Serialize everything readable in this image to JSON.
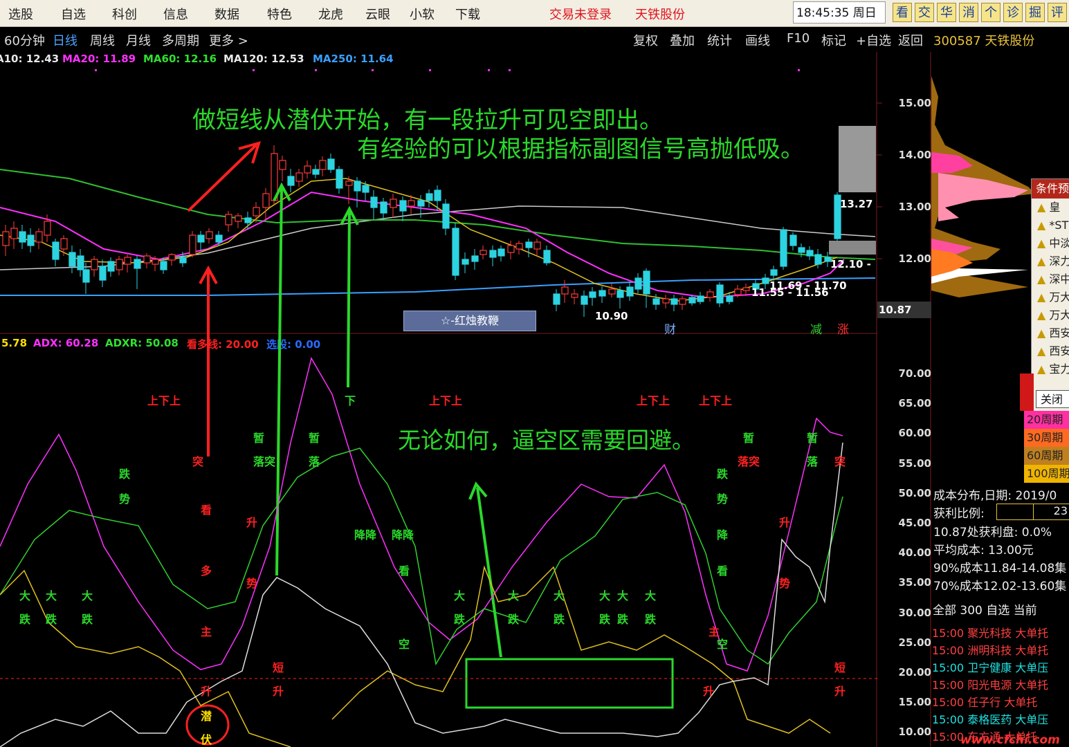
{
  "topbar": {
    "menu": [
      "选股",
      "自选",
      "科创",
      "信息",
      "数据",
      "特色",
      "龙虎",
      "云眼",
      "小软",
      "下载"
    ],
    "login_status": "交易未登录",
    "company": "天铁股份",
    "time": "18:45:35",
    "weekday": "周日",
    "quick_buttons": [
      "看",
      "交",
      "华",
      "消",
      "个",
      "诊",
      "掘",
      "评"
    ]
  },
  "subbar": {
    "periods": [
      "60分钟",
      "日线",
      "周线",
      "月线",
      "多周期",
      "更多 >"
    ],
    "active_period": "日线",
    "tools": [
      "复权",
      "叠加",
      "统计",
      "画线",
      "F10",
      "标记",
      "+自选",
      "返回"
    ],
    "stock_code_name": "300587 天铁股份"
  },
  "ma_legend": [
    {
      "text": "A10: 12.43",
      "color": "#e8e8e8"
    },
    {
      "text": "MA20: 11.89",
      "color": "#ff30ff"
    },
    {
      "text": "MA60: 12.16",
      "color": "#30e030"
    },
    {
      "text": "MA120: 12.53",
      "color": "#e8e8e8"
    },
    {
      "text": "MA250: 11.64",
      "color": "#3aa0ff"
    }
  ],
  "adx_legend": [
    {
      "text": "5.78",
      "color": "#ffe000"
    },
    {
      "text": "ADX: 60.28",
      "color": "#ff30ff"
    },
    {
      "text": "ADXR: 50.08",
      "color": "#30e030"
    },
    {
      "text": "看多线: 20.00",
      "color": "#ff2020"
    },
    {
      "text": "选股: 0.00",
      "color": "#2a6bff"
    }
  ],
  "price_axis": [
    "15.00",
    "14.00",
    "13.00",
    "12.00"
  ],
  "low_axis_label": "10.87",
  "indicator_axis": [
    "70.00",
    "65.00",
    "60.00",
    "55.00",
    "50.00",
    "45.00",
    "40.00",
    "35.00",
    "30.00",
    "25.00",
    "20.00",
    "15.00",
    "10.00"
  ],
  "price_labels": {
    "high": "13.27",
    "last": "12.10 -",
    "low": "10.90",
    "near1": "11.69 - 11.70",
    "near2": "11.55 - 11.56"
  },
  "pattern_badge": "☆-红烛教鞭",
  "event_markers": [
    "财",
    "减",
    "涨"
  ],
  "annotations": {
    "line1": "做短线从潜伏开始，有一段拉升可见空即出。",
    "line2": "有经验的可以根据指标副图信号高抛低吸。",
    "line3": "无论如何，逼空区需要回避。"
  },
  "signals": {
    "shang_xia": "上下上",
    "xia": "下",
    "zan": "暂",
    "luo": "落",
    "luo_tu": "落突",
    "tu": "突",
    "die": "跌",
    "shi": "势",
    "kan": "看",
    "sheng": "升",
    "duo": "多",
    "zhu": "主",
    "kong": "空",
    "da": "大",
    "duan": "短",
    "qian": "潜",
    "fu": "伏",
    "xiang_jiang": "降降",
    "jiang": "降"
  },
  "right_panel": {
    "popup_title": "条件预",
    "popup_items": [
      "皇",
      "*ST",
      "中淡",
      "深力",
      "深中",
      "万大",
      "万大",
      "西安",
      "西安",
      "宝力"
    ],
    "close_btn": "关闭",
    "periods": [
      "20周期",
      "30周期",
      "60周期",
      "100周期"
    ],
    "cost_date": "成本分布,日期: 2019/0",
    "profit_ratio_label": "获利比例:",
    "profit_ratio_value": "23",
    "profit_at": "10.87处获利盘: 0.0%",
    "avg_cost": "平均成本: 13.00元",
    "cost90": "90%成本11.84-14.08集",
    "cost70": "70%成本12.02-13.60集",
    "list_header": "全部 300  自选  当前",
    "stocks": [
      {
        "time": "15:00",
        "name": "聚光科技",
        "type": "大单托",
        "color": "#ff4040"
      },
      {
        "time": "15:00",
        "name": "洲明科技",
        "type": "大单托",
        "color": "#ff4040"
      },
      {
        "time": "15:00",
        "name": "卫宁健康",
        "type": "大单压",
        "color": "#20e0e0"
      },
      {
        "time": "15:00",
        "name": "阳光电源",
        "type": "大单托",
        "color": "#ff4040"
      },
      {
        "time": "15:00",
        "name": "任子行",
        "type": "大单托",
        "color": "#ff4040"
      },
      {
        "time": "15:00",
        "name": "泰格医药",
        "type": "大单压",
        "color": "#20e0e0"
      },
      {
        "time": "15:00",
        "name": "东方通",
        "type": "大单托",
        "color": "#ff4040"
      }
    ]
  },
  "watermark": "www.cfchi.com"
}
